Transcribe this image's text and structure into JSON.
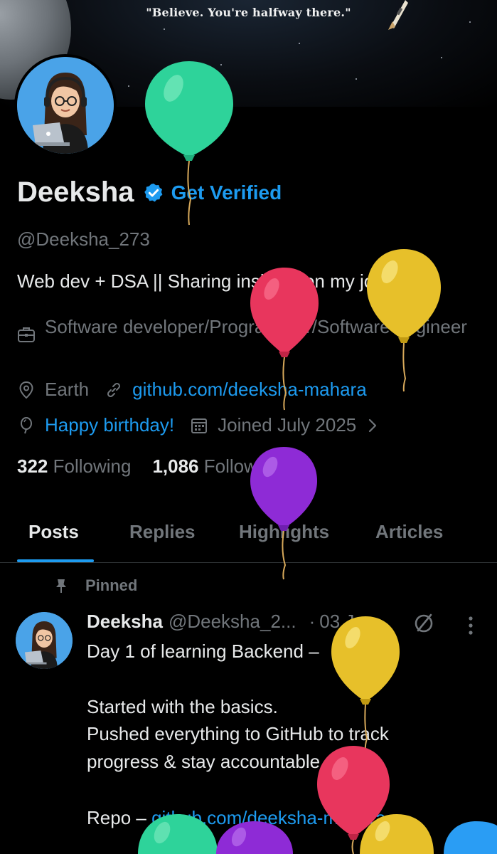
{
  "banner": {
    "quote": "\"Believe. You're halfway there.\""
  },
  "profile": {
    "name": "Deeksha",
    "get_verified": "Get Verified",
    "handle": "@Deeksha_273",
    "bio": "Web dev + DSA || Sharing insights on my journey",
    "job": "Software developer/Programmer/Software engineer",
    "location": "Earth",
    "website": "github.com/deeksha-mahara",
    "birthday": "Happy birthday!",
    "joined": "Joined July 2025",
    "following_count": "322",
    "following_label": "Following",
    "followers_count": "1,086",
    "followers_label": "Followers"
  },
  "tabs": [
    {
      "label": "Posts",
      "active": true
    },
    {
      "label": "Replies"
    },
    {
      "label": "Highlights"
    },
    {
      "label": "Articles"
    }
  ],
  "post": {
    "pinned_label": "Pinned",
    "author_name": "Deeksha",
    "author_handle": "@Deeksha_2...",
    "separator": "·",
    "date": "03 Jan",
    "lines": [
      "Day 1 of learning Backend –",
      "Started with the basics.",
      "Pushed everything to GitHub to track",
      "progress & stay accountable."
    ],
    "repo_prefix": "Repo – ",
    "repo_link": "github.com/deeksha-mahara..."
  },
  "icons": {
    "verified": "verified-badge-icon",
    "job": "briefcase-icon",
    "location": "map-pin-icon",
    "link": "link-icon",
    "birthday": "balloon-icon",
    "calendar": "calendar-icon",
    "chevron": "chevron-right-icon",
    "pin": "pin-icon",
    "grok": "grok-icon",
    "more": "more-vertical-icon"
  },
  "colors": {
    "accent": "#1d9bf0",
    "text": "#e7e9ea",
    "muted": "#71767b",
    "background": "#000000",
    "balloon_green": "#2ed39a",
    "balloon_red": "#e8365d",
    "balloon_yellow": "#e7c02a",
    "balloon_purple": "#8e2bd6"
  }
}
